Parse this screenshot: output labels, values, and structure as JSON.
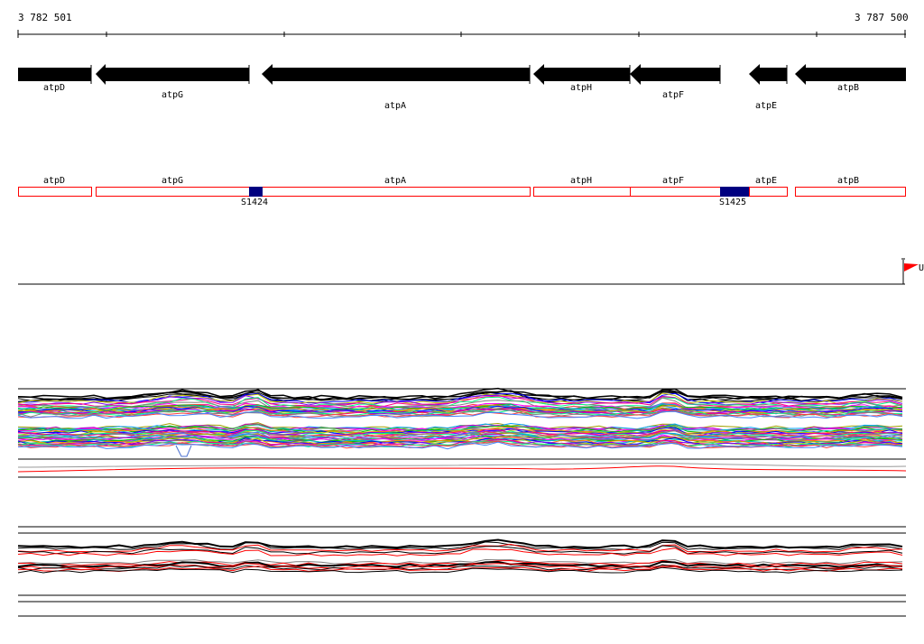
{
  "ruler": {
    "start_label": "3 782 501",
    "end_label": "3 787 500"
  },
  "genes": [
    {
      "name": "atpD"
    },
    {
      "name": "atpG"
    },
    {
      "name": "atpA"
    },
    {
      "name": "atpH"
    },
    {
      "name": "atpF"
    },
    {
      "name": "atpE"
    },
    {
      "name": "atpB"
    }
  ],
  "features": [
    {
      "name": "S1424"
    },
    {
      "name": "S1425"
    }
  ],
  "flag": {
    "label": "U",
    "color": "#ff0000"
  },
  "colors": {
    "gene_fill": "#000000",
    "segment_border": "#ff0000",
    "feature_fill": "#000080"
  }
}
